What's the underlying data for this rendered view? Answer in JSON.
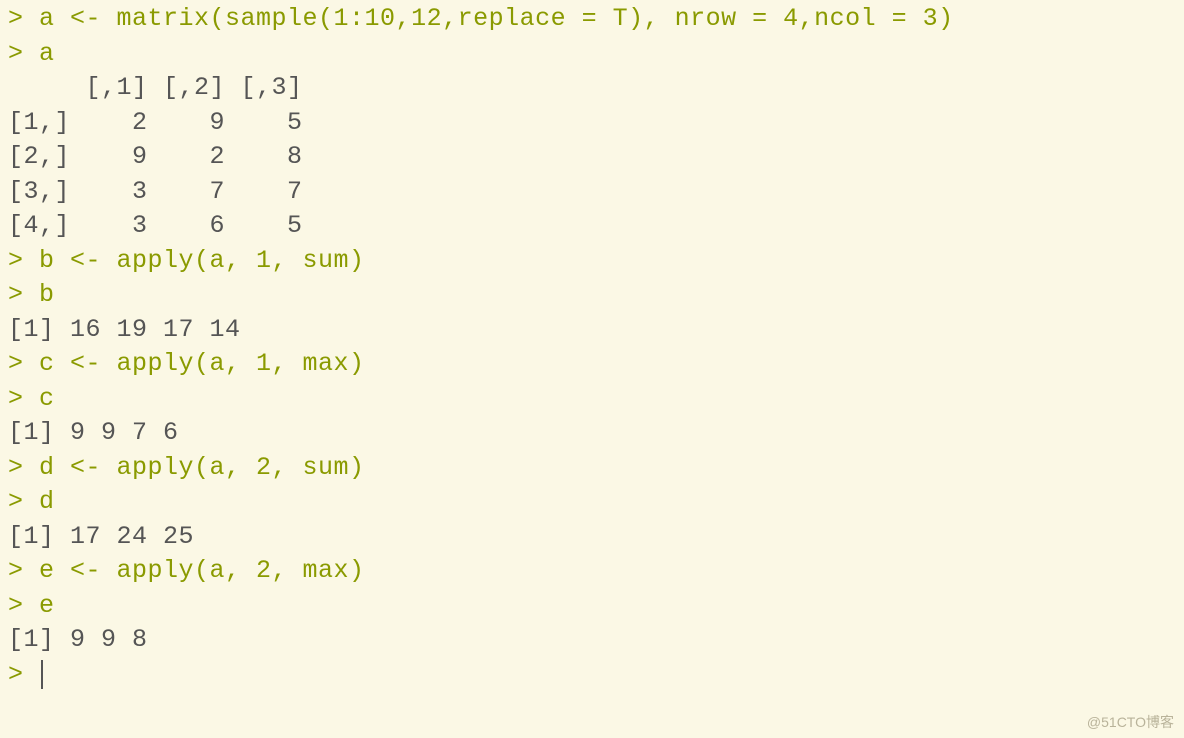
{
  "lines": [
    {
      "cls": "prompt",
      "text": "> a <- matrix(sample(1:10,12,replace = T), nrow = 4,ncol = 3)"
    },
    {
      "cls": "prompt",
      "text": "> a"
    },
    {
      "cls": "out",
      "text": "     [,1] [,2] [,3]"
    },
    {
      "cls": "out",
      "text": "[1,]    2    9    5"
    },
    {
      "cls": "out",
      "text": "[2,]    9    2    8"
    },
    {
      "cls": "out",
      "text": "[3,]    3    7    7"
    },
    {
      "cls": "out",
      "text": "[4,]    3    6    5"
    },
    {
      "cls": "prompt",
      "text": "> b <- apply(a, 1, sum)"
    },
    {
      "cls": "prompt",
      "text": "> b"
    },
    {
      "cls": "out",
      "text": "[1] 16 19 17 14"
    },
    {
      "cls": "prompt",
      "text": "> c <- apply(a, 1, max)"
    },
    {
      "cls": "prompt",
      "text": "> c"
    },
    {
      "cls": "out",
      "text": "[1] 9 9 7 6"
    },
    {
      "cls": "prompt",
      "text": "> d <- apply(a, 2, sum)"
    },
    {
      "cls": "prompt",
      "text": "> d"
    },
    {
      "cls": "out",
      "text": "[1] 17 24 25"
    },
    {
      "cls": "prompt",
      "text": "> e <- apply(a, 2, max)"
    },
    {
      "cls": "prompt",
      "text": "> e"
    },
    {
      "cls": "out",
      "text": "[1] 9 9 8"
    },
    {
      "cls": "prompt",
      "text": "> ",
      "cursor": true
    }
  ],
  "watermark": "@51CTO博客"
}
